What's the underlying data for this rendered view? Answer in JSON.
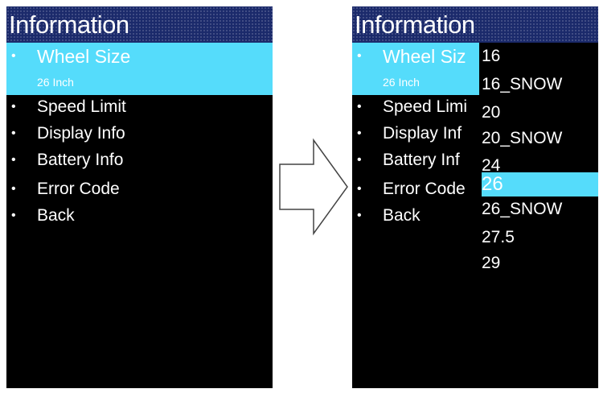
{
  "left_screen": {
    "header": {
      "title": "Information"
    },
    "selected_sub_value": "26 Inch",
    "menu": [
      {
        "label": "Wheel Size"
      },
      {
        "label": "Speed Limit"
      },
      {
        "label": "Display Info"
      },
      {
        "label": "Battery Info"
      },
      {
        "label": "Error Code"
      },
      {
        "label": "Back"
      }
    ]
  },
  "right_screen": {
    "header": {
      "title": "Information"
    },
    "selected_sub_value": "26 Inch",
    "menu": [
      {
        "label": "Wheel Siz"
      },
      {
        "label": "Speed Limi"
      },
      {
        "label": "Display Inf"
      },
      {
        "label": "Battery Inf"
      },
      {
        "label": "Error Code"
      },
      {
        "label": "Back"
      }
    ],
    "dropdown": {
      "options": [
        "16",
        "16_SNOW",
        "20",
        "20_SNOW",
        "24",
        "26",
        "26_SNOW",
        "27.5",
        "29"
      ],
      "selected": "26"
    }
  },
  "colors": {
    "header_bg": "#1b2a6b",
    "highlight": "#55dcfb",
    "screen_bg": "#000000",
    "text": "#ffffff"
  },
  "icons": {
    "transition_arrow": "right-arrow-icon",
    "bullet": "bullet-icon"
  }
}
